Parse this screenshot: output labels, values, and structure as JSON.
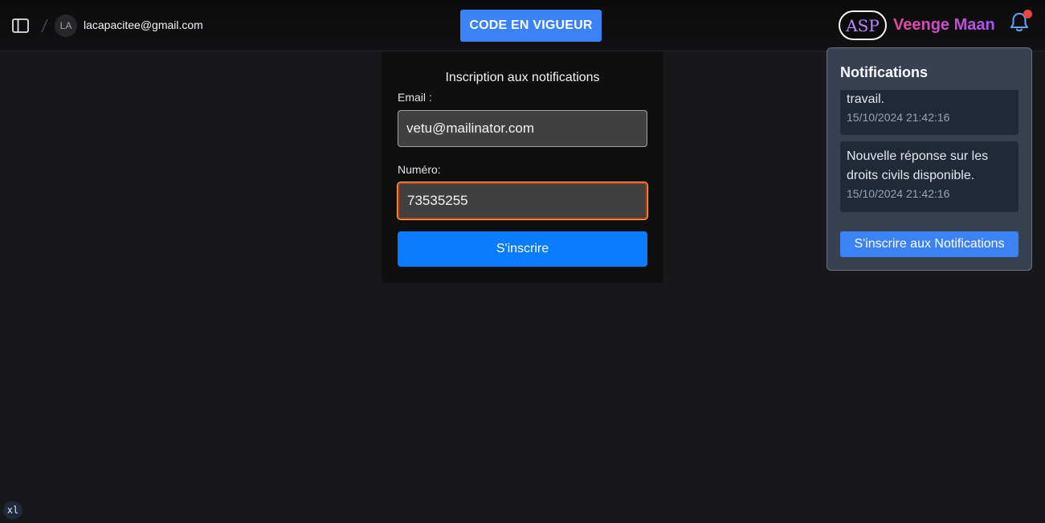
{
  "header": {
    "avatar_initials": "LA",
    "user_email": "lacapacitee@gmail.com",
    "code_button": "CODE EN VIGUEUR",
    "logo_text": "ASP",
    "brand_name": "Veenge Maan",
    "icons": [
      "sidebar-toggle-icon",
      "bell-icon"
    ]
  },
  "form": {
    "title": "Inscription aux notifications",
    "email_label": "Email :",
    "email_value": "vetu@mailinator.com",
    "phone_label": "Numéro:",
    "phone_value": "73535255",
    "submit_label": "S'inscrire"
  },
  "notifications": {
    "title": "Notifications",
    "items": [
      {
        "text": "travail.",
        "time": "15/10/2024 21:42:16"
      },
      {
        "text": "Nouvelle réponse sur les droits civils disponible.",
        "time": "15/10/2024 21:42:16"
      }
    ],
    "subscribe_label": "S'inscrire aux Notifications"
  },
  "breakpoint_badge": "xl",
  "colors": {
    "accent": "#3b82f6",
    "submit": "#0a7cff",
    "notification_dot": "#ef4444",
    "brand_gradient_start": "#ec4899",
    "brand_gradient_end": "#a855f7"
  }
}
